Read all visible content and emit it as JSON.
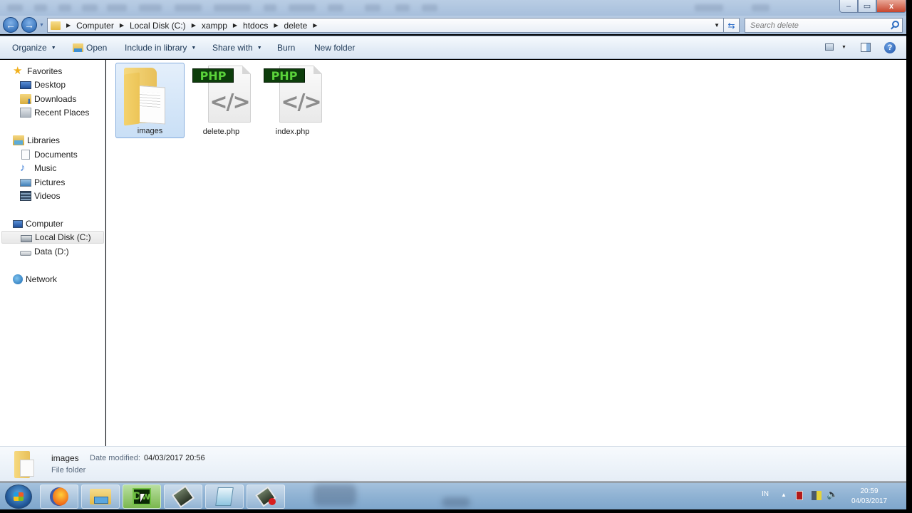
{
  "window": {
    "controls": {
      "minimize": "–",
      "maximize": "▭",
      "close": "x"
    }
  },
  "nav": {
    "back_icon": "arrow-left-icon",
    "forward_icon": "arrow-right-icon",
    "back_glyph": "←",
    "forward_glyph": "→",
    "breadcrumb": [
      "Computer",
      "Local Disk (C:)",
      "xampp",
      "htdocs",
      "delete"
    ],
    "refresh_glyph": "⇆",
    "search_placeholder": "Search delete"
  },
  "toolbar": {
    "organize": "Organize",
    "open": "Open",
    "include_in_library": "Include in library",
    "share_with": "Share with",
    "burn": "Burn",
    "new_folder": "New folder",
    "help_glyph": "?"
  },
  "sidebar": {
    "favorites": {
      "label": "Favorites",
      "items": [
        "Desktop",
        "Downloads",
        "Recent Places"
      ]
    },
    "libraries": {
      "label": "Libraries",
      "items": [
        "Documents",
        "Music",
        "Pictures",
        "Videos"
      ]
    },
    "computer": {
      "label": "Computer",
      "items": [
        "Local Disk (C:)",
        "Data (D:)"
      ],
      "selected": "Local Disk (C:)"
    },
    "network": {
      "label": "Network"
    },
    "star_glyph": "★",
    "music_glyph": "♪"
  },
  "files": [
    {
      "name": "images",
      "type": "folder",
      "selected": true
    },
    {
      "name": "delete.php",
      "type": "php",
      "tag": "PHP",
      "code_glyph": "</>"
    },
    {
      "name": "index.php",
      "type": "php",
      "tag": "PHP",
      "code_glyph": "</>"
    }
  ],
  "details": {
    "name": "images",
    "modified_label": "Date modified:",
    "modified_value": "04/03/2017 20:56",
    "type": "File folder"
  },
  "taskbar": {
    "apps": [
      "Firefox",
      "Windows Explorer",
      "Dreamweaver",
      "Application",
      "Notepad",
      "Application"
    ],
    "dw_label": "Dw",
    "active_app": "Dreamweaver",
    "tray": {
      "language": "IN",
      "show_hidden": "▲",
      "volume_glyph": "🔈",
      "time": "20:59",
      "date": "04/03/2017"
    }
  }
}
